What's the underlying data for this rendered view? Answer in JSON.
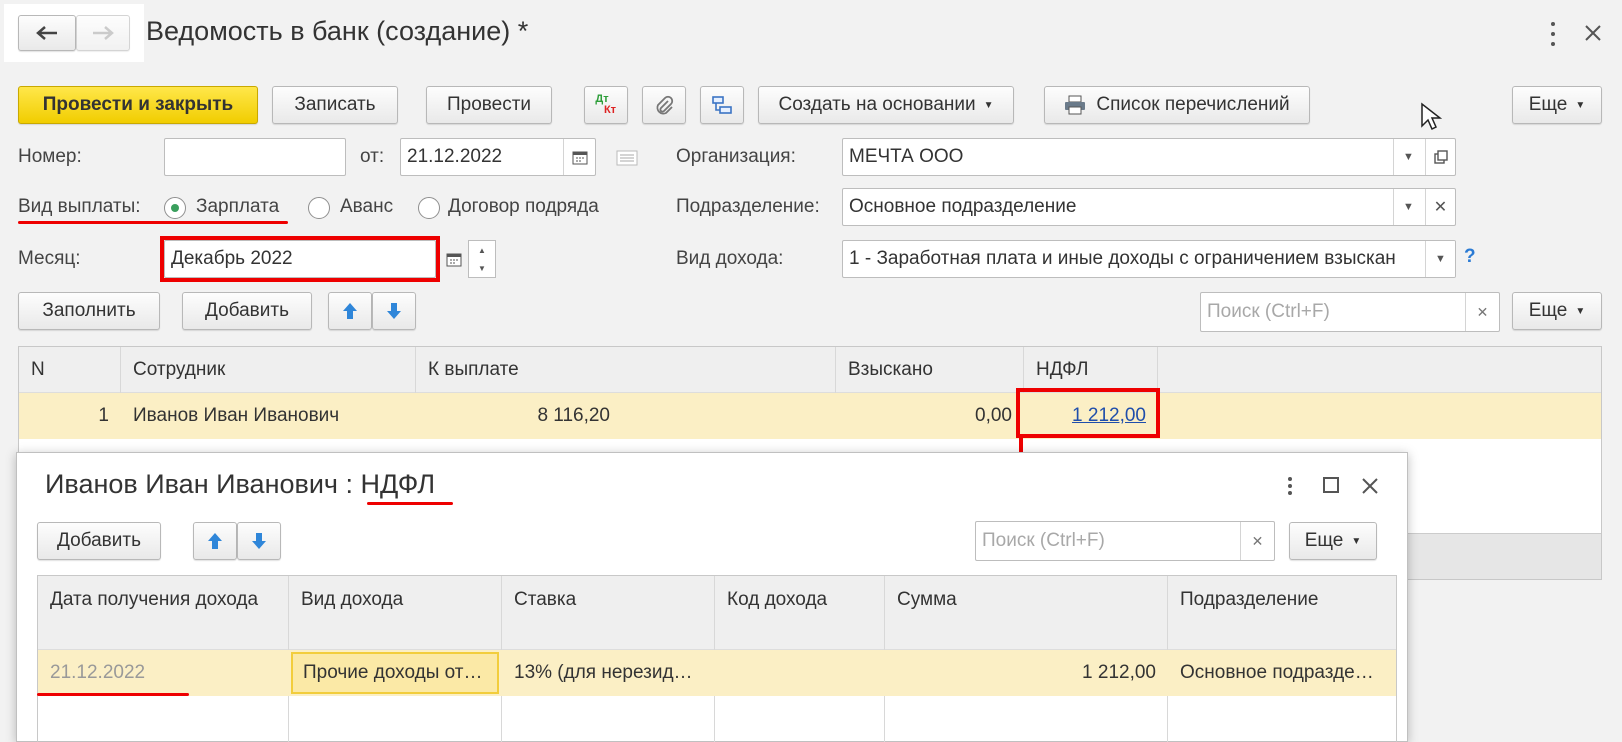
{
  "window": {
    "title": "Ведомость в банк (создание) *",
    "back_icon": "arrow-left-icon",
    "forward_icon": "arrow-right-icon",
    "menu_icon": "kebab-icon",
    "close_icon": "close-icon"
  },
  "toolbar": {
    "post_close": "Провести и закрыть",
    "save": "Записать",
    "post": "Провести",
    "dt_kt": "Дт",
    "kt": "Кт",
    "create_based": "Создать на основании",
    "transfer_list": "Список перечислений",
    "more": "Еще"
  },
  "form": {
    "number_label": "Номер:",
    "number_value": "",
    "from_label": "от:",
    "date_value": "21.12.2022",
    "org_label": "Организация:",
    "org_value": "МЕЧТА ООО",
    "payment_type_label": "Вид выплаты:",
    "payment_options": [
      "Зарплата",
      "Аванс",
      "Договор подряда"
    ],
    "payment_selected": "Зарплата",
    "subdivision_label": "Подразделение:",
    "subdivision_value": "Основное подразделение",
    "month_label": "Месяц:",
    "month_value": "Декабрь 2022",
    "income_type_label": "Вид дохода:",
    "income_type_value": "1 - Заработная плата и иные доходы с ограничением взыскан",
    "help": "?"
  },
  "table_toolbar": {
    "fill": "Заполнить",
    "add": "Добавить",
    "search_placeholder": "Поиск (Ctrl+F)",
    "more": "Еще"
  },
  "table": {
    "columns": [
      "N",
      "Сотрудник",
      "К выплате",
      "Взыскано",
      "НДФЛ"
    ],
    "rows": [
      {
        "n": "1",
        "employee": "Иванов Иван Иванович",
        "to_pay": "8 116,20",
        "collected": "0,00",
        "ndfl": "1 212,00"
      }
    ]
  },
  "dialog": {
    "title_prefix": "Иванов Иван Иванович : ",
    "title_highlight": "НДФЛ",
    "add": "Добавить",
    "search_placeholder": "Поиск (Ctrl+F)",
    "more": "Еще",
    "columns": [
      "Дата получения дохода",
      "Вид дохода",
      "Ставка",
      "Код дохода",
      "Сумма",
      "Подразделение"
    ],
    "rows": [
      {
        "date": "21.12.2022",
        "income_type": "Прочие доходы от…",
        "rate": "13% (для нерезид…",
        "code": "",
        "sum": "1 212,00",
        "subdivision": "Основное подразде…"
      }
    ]
  },
  "colors": {
    "accent_yellow": "#f4d30f",
    "annotation_red": "#ee0000",
    "row_highlight": "#fbefc5",
    "link_blue": "#1f4eab"
  }
}
